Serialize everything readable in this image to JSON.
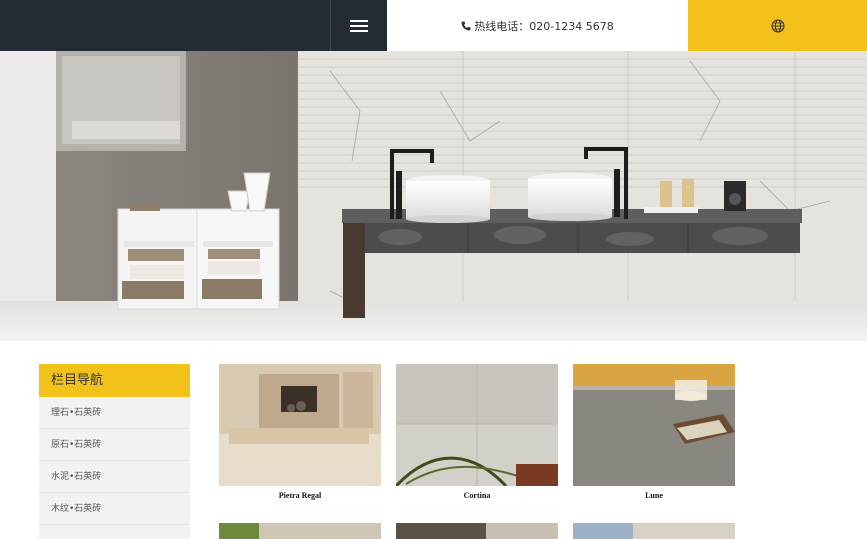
{
  "header": {
    "menu_icon": "hamburger-menu-icon",
    "hotline_label": "热线电话：020-1234 5678",
    "phone_icon": "phone-icon",
    "lang_icon": "globe-icon",
    "colors": {
      "dark": "#232c35",
      "accent": "#f2c21a"
    }
  },
  "banner": {
    "alt": ""
  },
  "sidebar": {
    "title": "栏目导航",
    "items": [
      {
        "label": "理石•石英砖"
      },
      {
        "label": "原石•石英砖"
      },
      {
        "label": "水泥•石英砖"
      },
      {
        "label": "木纹•石英砖"
      }
    ]
  },
  "products": [
    {
      "caption": "Pietra Regal"
    },
    {
      "caption": "Cortina"
    },
    {
      "caption": "Lune"
    }
  ]
}
